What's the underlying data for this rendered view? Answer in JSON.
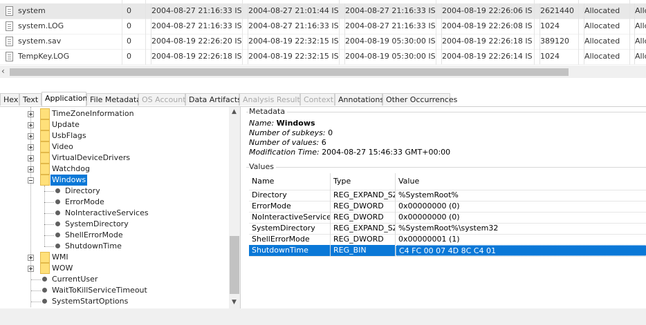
{
  "file_table": {
    "rows": [
      {
        "name": "system",
        "flag": "0",
        "c1": "2004-08-27 21:16:33 IST",
        "c2": "2004-08-27 21:01:44 IST",
        "c3": "2004-08-27 21:16:33 IST",
        "c4": "2004-08-19 22:26:06 IST",
        "size": "2621440",
        "alloc": "Allocated",
        "extra": "Allc"
      },
      {
        "name": "system.LOG",
        "flag": "0",
        "c1": "2004-08-27 21:16:33 IST",
        "c2": "2004-08-27 21:16:33 IST",
        "c3": "2004-08-27 21:16:33 IST",
        "c4": "2004-08-19 22:26:08 IST",
        "size": "1024",
        "alloc": "Allocated",
        "extra": "Allc"
      },
      {
        "name": "system.sav",
        "flag": "0",
        "c1": "2004-08-19 22:26:20 IST",
        "c2": "2004-08-19 22:32:15 IST",
        "c3": "2004-08-19 05:30:00 IST",
        "c4": "2004-08-19 22:26:18 IST",
        "size": "389120",
        "alloc": "Allocated",
        "extra": "Allc"
      },
      {
        "name": "TempKey.LOG",
        "flag": "0",
        "c1": "2004-08-19 22:26:18 IST",
        "c2": "2004-08-19 22:32:15 IST",
        "c3": "2004-08-19 05:30:00 IST",
        "c4": "2004-08-19 22:26:14 IST",
        "size": "1024",
        "alloc": "Allocated",
        "extra": "Allc"
      }
    ]
  },
  "tabs": [
    {
      "label": "Hex",
      "state": "normal"
    },
    {
      "label": "Text",
      "state": "normal"
    },
    {
      "label": "Application",
      "state": "active"
    },
    {
      "label": "File Metadata",
      "state": "normal"
    },
    {
      "label": "OS Account",
      "state": "disabled"
    },
    {
      "label": "Data Artifacts",
      "state": "normal"
    },
    {
      "label": "Analysis Results",
      "state": "disabled"
    },
    {
      "label": "Context",
      "state": "disabled"
    },
    {
      "label": "Annotations",
      "state": "normal"
    },
    {
      "label": "Other Occurrences",
      "state": "normal"
    }
  ],
  "tree": {
    "keys_top": [
      "TimeZoneInformation",
      "Update",
      "UsbFlags",
      "Video",
      "VirtualDeviceDrivers",
      "Watchdog"
    ],
    "selected_key": "Windows",
    "selected_values": [
      "Directory",
      "ErrorMode",
      "NoInteractiveServices",
      "SystemDirectory",
      "ShellErrorMode",
      "ShutdownTime"
    ],
    "keys_after": [
      "WMI",
      "WOW"
    ],
    "values_after": [
      "CurrentUser",
      "WaitToKillServiceTimeout",
      "SystemStartOptions"
    ]
  },
  "metadata": {
    "group_title": "Metadata",
    "name_label": "Name:",
    "name_value": "Windows",
    "subkeys_label": "Number of subkeys:",
    "subkeys_value": "0",
    "values_label": "Number of values:",
    "values_value": "6",
    "mtime_label": "Modification Time:",
    "mtime_value": "2004-08-27 15:46:33 GMT+00:00"
  },
  "values_table": {
    "group_title": "Values",
    "headers": {
      "name": "Name",
      "type": "Type",
      "value": "Value"
    },
    "rows": [
      {
        "name": "Directory",
        "type": "REG_EXPAND_SZ",
        "value": "%SystemRoot%"
      },
      {
        "name": "ErrorMode",
        "type": "REG_DWORD",
        "value": "0x00000000 (0)"
      },
      {
        "name": "NoInteractiveServices",
        "type": "REG_DWORD",
        "value": "0x00000000 (0)"
      },
      {
        "name": "SystemDirectory",
        "type": "REG_EXPAND_SZ",
        "value": "%SystemRoot%\\system32"
      },
      {
        "name": "ShellErrorMode",
        "type": "REG_DWORD",
        "value": "0x00000001 (1)"
      },
      {
        "name": "ShutdownTime",
        "type": "REG_BIN",
        "value": "C4 FC 00 07 4D 8C C4 01"
      }
    ],
    "selected_index": 5
  },
  "colors": {
    "selection": "#0a78d7",
    "folder": "#ffe07a"
  }
}
